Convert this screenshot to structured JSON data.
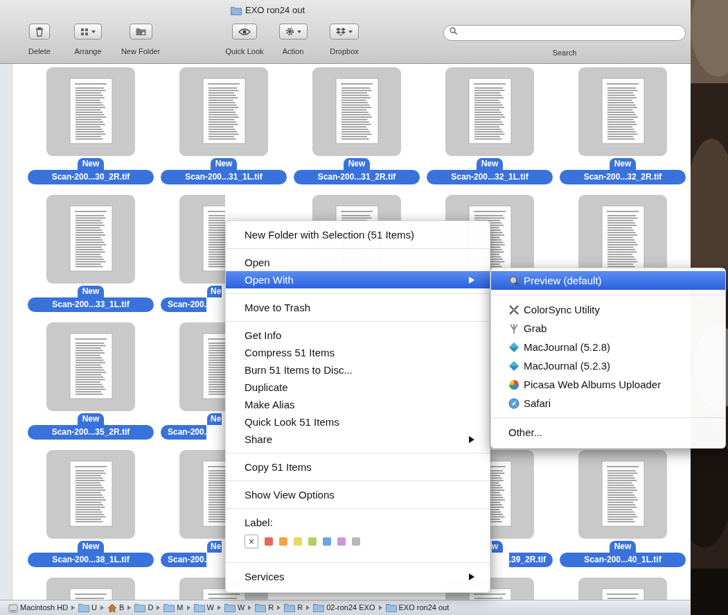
{
  "window": {
    "title": "EXO ron24 out"
  },
  "toolbar": {
    "buttons": [
      {
        "label": "Delete",
        "dropdown": false
      },
      {
        "label": "Arrange",
        "dropdown": true
      },
      {
        "label": "New Folder",
        "dropdown": false
      },
      {
        "label": "Quick Look",
        "dropdown": false
      },
      {
        "label": "Action",
        "dropdown": true
      },
      {
        "label": "Dropbox",
        "dropdown": true
      }
    ],
    "search": {
      "label": "Search"
    }
  },
  "files": [
    {
      "kind": "full",
      "selected": true,
      "badge": "New",
      "name": "Scan-200...30_2R.tif"
    },
    {
      "kind": "full",
      "selected": true,
      "badge": "New",
      "name": "Scan-200...31_1L.tif"
    },
    {
      "kind": "full",
      "selected": true,
      "badge": "New",
      "name": "Scan-200...31_2R.tif"
    },
    {
      "kind": "full",
      "selected": true,
      "badge": "New",
      "name": "Scan-200...32_1L.tif"
    },
    {
      "kind": "full",
      "selected": true,
      "badge": "New",
      "name": "Scan-200...32_2R.tif"
    },
    {
      "kind": "full",
      "selected": true,
      "badge": "New",
      "name": "Scan-200...33_1L.tif"
    },
    {
      "kind": "cut_right",
      "selected": true,
      "badge": "Ne",
      "name": "Scan-200."
    },
    {
      "kind": "unlabeled",
      "selected": true
    },
    {
      "kind": "unlabeled",
      "selected": true
    },
    {
      "kind": "unlabeled",
      "selected": true
    },
    {
      "kind": "full",
      "selected": true,
      "badge": "New",
      "name": "Scan-200...35_2R.tif"
    },
    {
      "kind": "cut_right",
      "selected": true,
      "badge": "Ne",
      "name": "Scan-200."
    },
    {
      "kind": "hidden"
    },
    {
      "kind": "hidden"
    },
    {
      "kind": "hidden"
    },
    {
      "kind": "full",
      "selected": true,
      "badge": "New",
      "name": "Scan-200...38_1L.tif"
    },
    {
      "kind": "cut_right",
      "selected": true,
      "badge": "Ne",
      "name": "Scan-200."
    },
    {
      "kind": "hidden"
    },
    {
      "kind": "cut_left",
      "selected": true,
      "badge": "w",
      "name": ".39_2R.tif"
    },
    {
      "kind": "full",
      "selected": true,
      "badge": "New",
      "name": "Scan-200...40_1L.tif"
    },
    {
      "kind": "unlabeled",
      "selected": true
    },
    {
      "kind": "unlabeled",
      "selected": true
    },
    {
      "kind": "hidden"
    },
    {
      "kind": "unlabeled",
      "selected": true
    },
    {
      "kind": "unlabeled",
      "selected": true
    }
  ],
  "path_bar": {
    "items": [
      {
        "kind": "disk",
        "label": "Macintosh HD"
      },
      {
        "kind": "folder",
        "label": "U"
      },
      {
        "kind": "home",
        "label": "B"
      },
      {
        "kind": "folder",
        "label": "D"
      },
      {
        "kind": "folder",
        "label": "M"
      },
      {
        "kind": "folder",
        "label": "W"
      },
      {
        "kind": "folder",
        "label": "W"
      },
      {
        "kind": "folder",
        "label": "R"
      },
      {
        "kind": "folder",
        "label": "R"
      },
      {
        "kind": "folder",
        "label": "02-ron24 EXO"
      },
      {
        "kind": "folder",
        "label": "EXO ron24 out"
      }
    ]
  },
  "context_menu": {
    "sections": [
      {
        "kind": "commands",
        "items": [
          {
            "label": "New Folder with Selection (51 Items)",
            "selected": false,
            "submenu": false
          }
        ]
      },
      {
        "kind": "commands",
        "items": [
          {
            "label": "Open",
            "selected": false,
            "submenu": false
          },
          {
            "label": "Open With",
            "selected": true,
            "submenu": true
          }
        ]
      },
      {
        "kind": "commands",
        "items": [
          {
            "label": "Move to Trash",
            "selected": false,
            "submenu": false
          }
        ]
      },
      {
        "kind": "commands",
        "items": [
          {
            "label": "Get Info",
            "selected": false,
            "submenu": false
          },
          {
            "label": "Compress 51 Items",
            "selected": false,
            "submenu": false
          },
          {
            "label": "Burn 51 Items to Disc...",
            "selected": false,
            "submenu": false
          },
          {
            "label": "Duplicate",
            "selected": false,
            "submenu": false
          },
          {
            "label": "Make Alias",
            "selected": false,
            "submenu": false
          },
          {
            "label": "Quick Look 51 Items",
            "selected": false,
            "submenu": false
          },
          {
            "label": "Share",
            "selected": false,
            "submenu": true
          }
        ]
      },
      {
        "kind": "commands",
        "items": [
          {
            "label": "Copy 51 Items",
            "selected": false,
            "submenu": false
          }
        ]
      },
      {
        "kind": "commands",
        "items": [
          {
            "label": "Show View Options",
            "selected": false,
            "submenu": false
          }
        ]
      },
      {
        "kind": "labels",
        "title": "Label:",
        "clear": "×",
        "swatches": [
          {
            "color": "#e8655b"
          },
          {
            "color": "#f0a54a"
          },
          {
            "color": "#e6da5c"
          },
          {
            "color": "#b3d15a"
          },
          {
            "color": "#6aa8e6"
          },
          {
            "color": "#c49ae0"
          },
          {
            "color": "#b8b8b8"
          }
        ]
      },
      {
        "kind": "commands",
        "items": [
          {
            "label": "Services",
            "selected": false,
            "submenu": true
          }
        ]
      }
    ]
  },
  "open_with_menu": {
    "sections": [
      {
        "items": [
          {
            "label": "Preview (default)",
            "selected": true,
            "icon": true
          }
        ]
      },
      {
        "items": [
          {
            "label": "ColorSync Utility",
            "selected": false,
            "icon": true
          },
          {
            "label": "Grab",
            "selected": false,
            "icon": true
          },
          {
            "label": "MacJournal (5.2.8)",
            "selected": false,
            "icon": true
          },
          {
            "label": "MacJournal (5.2.3)",
            "selected": false,
            "icon": true
          },
          {
            "label": "Picasa Web Albums Uploader",
            "selected": false,
            "icon": true
          },
          {
            "label": "Safari",
            "selected": false,
            "icon": true
          }
        ]
      },
      {
        "items": [
          {
            "label": "Other...",
            "selected": false,
            "icon": false
          }
        ]
      }
    ]
  }
}
